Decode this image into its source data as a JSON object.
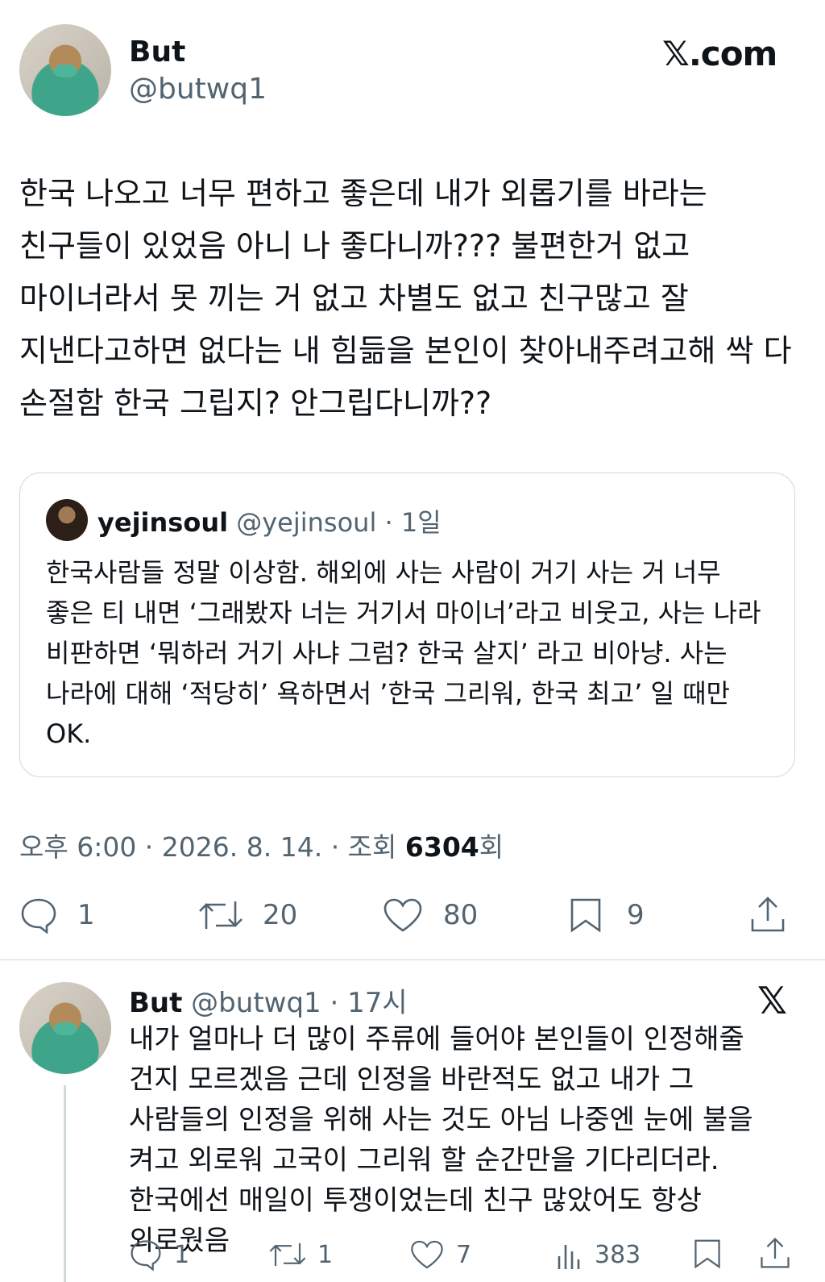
{
  "tweet": {
    "author_name": "But",
    "author_handle": "@butwq1",
    "brand": "𝕏.com",
    "body": "한국 나오고 너무 편하고 좋은데 내가 외롭기를 바라는 친구들이 있었음 아니 나 좋다니까??? 불편한거 없고 마이너라서 못 끼는 거 없고 차별도 없고 친구많고 잘 지낸다고하면 없다는 내 힘듦을 본인이 찾아내주려고해 싹 다 손절함 한국 그립지? 안그립다니까??",
    "timestamp": "오후 6:00 · 2026. 8. 14. · 조회 ",
    "views": "6304",
    "views_suffix": "회",
    "counts": {
      "replies": "1",
      "retweets": "20",
      "likes": "80",
      "bookmarks": "9"
    }
  },
  "quote": {
    "name": "yejinsoul",
    "meta": " @yejinsoul · 1일",
    "text": "한국사람들 정말 이상함. 해외에 사는 사람이 거기 사는 거 너무 좋은 티 내면 ‘그래봤자 너는 거기서 마이너’라고 비웃고, 사는 나라 비판하면 ‘뭐하러 거기 사냐 그럼? 한국 살지’ 라고 비아냥. 사는 나라에 대해 ‘적당히’ 욕하면서 ’한국 그리워, 한국 최고’ 일 때만 OK."
  },
  "reply": {
    "name": "But",
    "meta": " @butwq1 · 17시",
    "x_logo": "𝕏",
    "text": "내가 얼마나 더 많이 주류에 들어야 본인들이 인정해줄 건지 모르겠음 근데 인정을 바란적도 없고 내가 그 사람들의 인정을 위해 사는 것도 아님 나중엔 눈에 불을 켜고 외로워 고국이 그리워 할 순간만을 기다리더라. 한국에선 매일이 투쟁이었는데 친구 많았어도 항상 외로웠음",
    "counts": {
      "replies": "1",
      "retweets": "1",
      "likes": "7",
      "views": "383"
    }
  },
  "icons": [
    "reply-icon",
    "retweet-icon",
    "like-icon",
    "bookmark-icon",
    "share-icon",
    "views-icon",
    "x-logo-icon"
  ]
}
